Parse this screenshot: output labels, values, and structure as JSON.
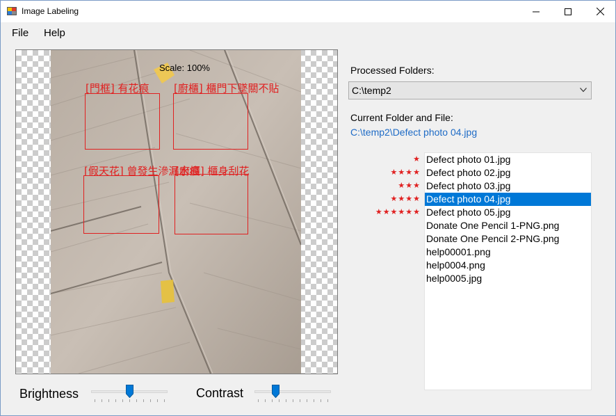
{
  "window": {
    "title": "Image Labeling"
  },
  "menu": {
    "file": "File",
    "help": "Help"
  },
  "canvas": {
    "scale_text": "Scale: 100%",
    "annotations": [
      {
        "label": "[門框] 有花痕"
      },
      {
        "label": "[廚櫃] 櫃門下墜關不貼"
      },
      {
        "label": "[假天花] 曾發生滲漏水痕"
      },
      {
        "label": "[廚櫃] 櫃身刮花"
      }
    ]
  },
  "controls": {
    "brightness_label": "Brightness",
    "brightness_value": 0.5,
    "contrast_label": "Contrast",
    "contrast_value": 0.25
  },
  "panel": {
    "processed_folders_label": "Processed Folders:",
    "processed_folder_value": "C:\\temp2",
    "current_label": "Current Folder and File:",
    "current_path": "C:\\temp2\\Defect photo 04.jpg"
  },
  "files": [
    {
      "name": "Defect photo 01.jpg",
      "stars": "★",
      "selected": false
    },
    {
      "name": "Defect photo 02.jpg",
      "stars": "★★★★",
      "selected": false
    },
    {
      "name": "Defect photo 03.jpg",
      "stars": "★★★",
      "selected": false
    },
    {
      "name": "Defect photo 04.jpg",
      "stars": "★★★★",
      "selected": true
    },
    {
      "name": "Defect photo 05.jpg",
      "stars": "★★★★★★",
      "selected": false
    },
    {
      "name": "Donate One Pencil 1-PNG.png",
      "stars": "",
      "selected": false
    },
    {
      "name": "Donate One Pencil 2-PNG.png",
      "stars": "",
      "selected": false
    },
    {
      "name": "help00001.png",
      "stars": "",
      "selected": false
    },
    {
      "name": "help0004.png",
      "stars": "",
      "selected": false
    },
    {
      "name": "help0005.jpg",
      "stars": "",
      "selected": false
    }
  ],
  "colors": {
    "accent": "#0078d7",
    "annotation": "#e02020",
    "link": "#1e6bc6"
  }
}
